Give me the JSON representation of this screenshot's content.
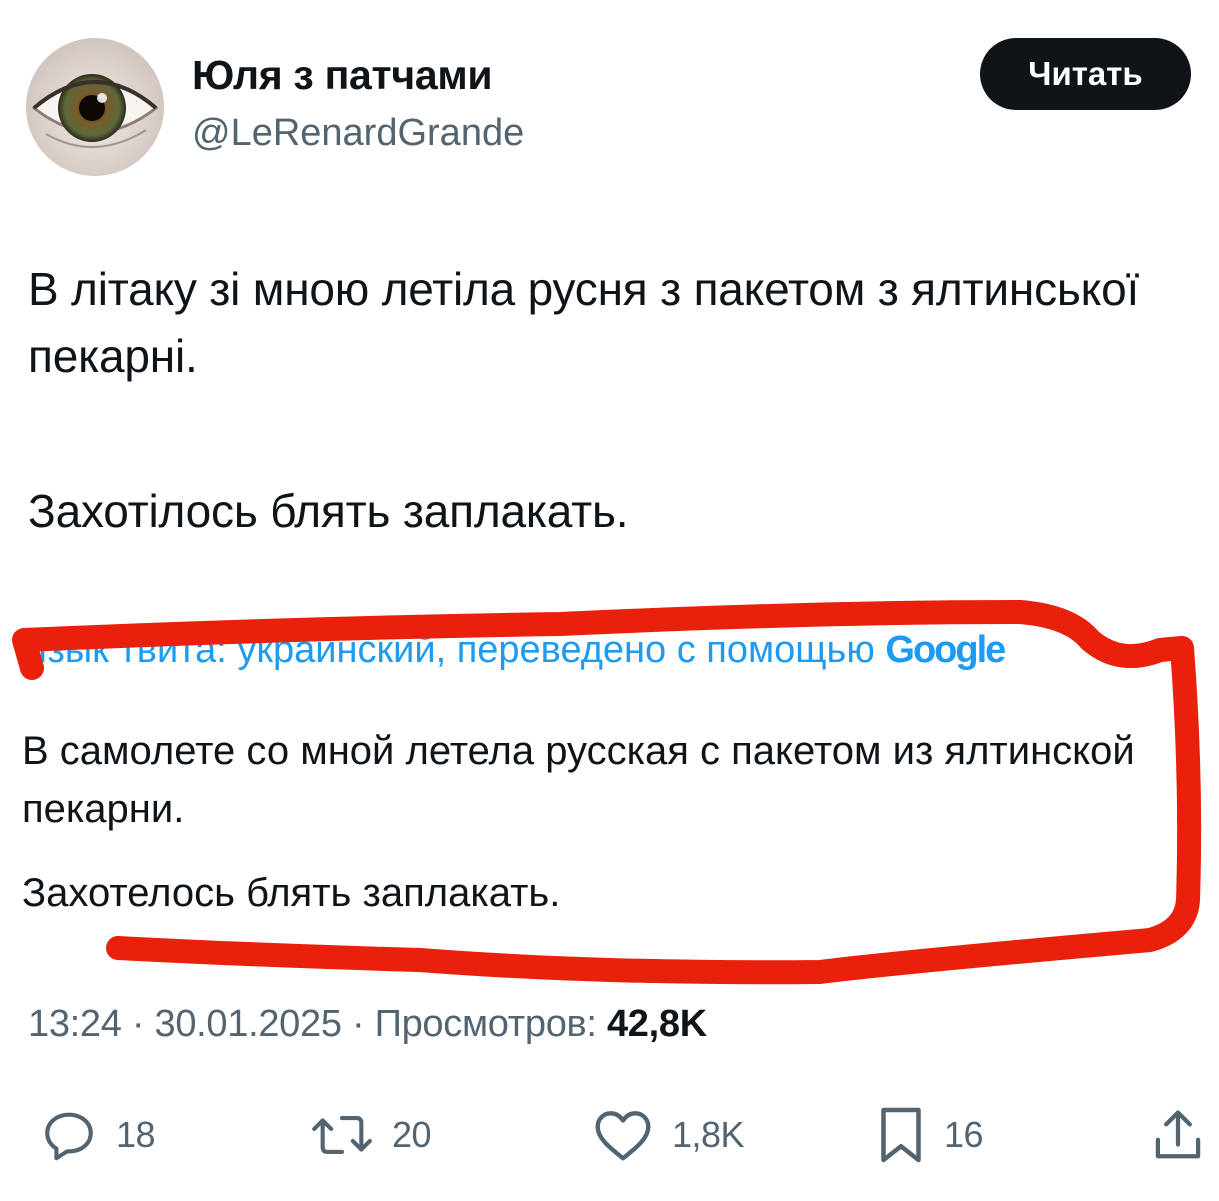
{
  "author": {
    "display_name": "Юля з патчами",
    "handle": "@LeRenardGrande"
  },
  "follow_button_label": "Читать",
  "tweet": {
    "paragraphs": [
      "В літаку зі мною летіла русня з пакетом з ялтинської пекарні.",
      "Захотілось блять заплакать."
    ]
  },
  "translation": {
    "note": "Язык твита: украинский, переведено с помощью",
    "provider_logo": "Google",
    "paragraphs": [
      "В самолете со мной летела русская с пакетом из ялтинской пекарни.",
      "Захотелось блять заплакать."
    ]
  },
  "meta": {
    "time": "13:24",
    "separator": "·",
    "date": "30.01.2025",
    "views_label": "Просмотров:",
    "views_count": "42,8K"
  },
  "actions": {
    "replies": "18",
    "reposts": "20",
    "likes": "1,8K",
    "bookmarks": "16"
  },
  "icons": {
    "avatar": "eye-photo",
    "reply": "reply-icon",
    "repost": "repost-icon",
    "like": "heart-icon",
    "bookmark": "bookmark-icon",
    "share": "share-icon"
  },
  "colors": {
    "text": "#0f1419",
    "secondary": "#536471",
    "link": "#1d9bf0",
    "button_bg": "#0f1419",
    "markup_red": "#e8200c"
  }
}
